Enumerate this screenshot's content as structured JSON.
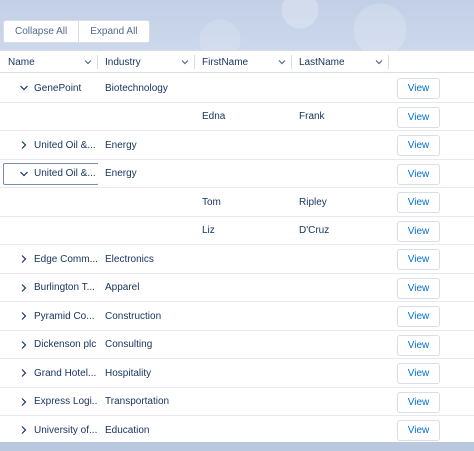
{
  "toolbar": {
    "collapse_all_label": "Collapse All",
    "expand_all_label": "Expand All"
  },
  "columns": [
    "Name",
    "Industry",
    "FirstName",
    "LastName"
  ],
  "view_label": "View",
  "rows": [
    {
      "type": "account",
      "expanded": true,
      "name": "GenePoint",
      "industry": "Biotechnology",
      "first": "",
      "last": ""
    },
    {
      "type": "contact",
      "name": "",
      "industry": "",
      "first": "Edna",
      "last": "Frank"
    },
    {
      "type": "account",
      "expanded": false,
      "name": "United Oil &...",
      "industry": "Energy",
      "first": "",
      "last": ""
    },
    {
      "type": "account",
      "expanded": true,
      "name": "United Oil &...",
      "industry": "Energy",
      "first": "",
      "last": "",
      "focused": true
    },
    {
      "type": "contact",
      "name": "",
      "industry": "",
      "first": "Tom",
      "last": "Ripley"
    },
    {
      "type": "contact",
      "name": "",
      "industry": "",
      "first": "Liz",
      "last": "D'Cruz"
    },
    {
      "type": "account",
      "expanded": false,
      "name": "Edge Comm...",
      "industry": "Electronics",
      "first": "",
      "last": ""
    },
    {
      "type": "account",
      "expanded": false,
      "name": "Burlington T...",
      "industry": "Apparel",
      "first": "",
      "last": ""
    },
    {
      "type": "account",
      "expanded": false,
      "name": "Pyramid Co...",
      "industry": "Construction",
      "first": "",
      "last": ""
    },
    {
      "type": "account",
      "expanded": false,
      "name": "Dickenson plc",
      "industry": "Consulting",
      "first": "",
      "last": ""
    },
    {
      "type": "account",
      "expanded": false,
      "name": "Grand Hotel...",
      "industry": "Hospitality",
      "first": "",
      "last": ""
    },
    {
      "type": "account",
      "expanded": false,
      "name": "Express Logi...",
      "industry": "Transportation",
      "first": "",
      "last": ""
    },
    {
      "type": "account",
      "expanded": false,
      "name": "University of...",
      "industry": "Education",
      "first": "",
      "last": ""
    }
  ]
}
